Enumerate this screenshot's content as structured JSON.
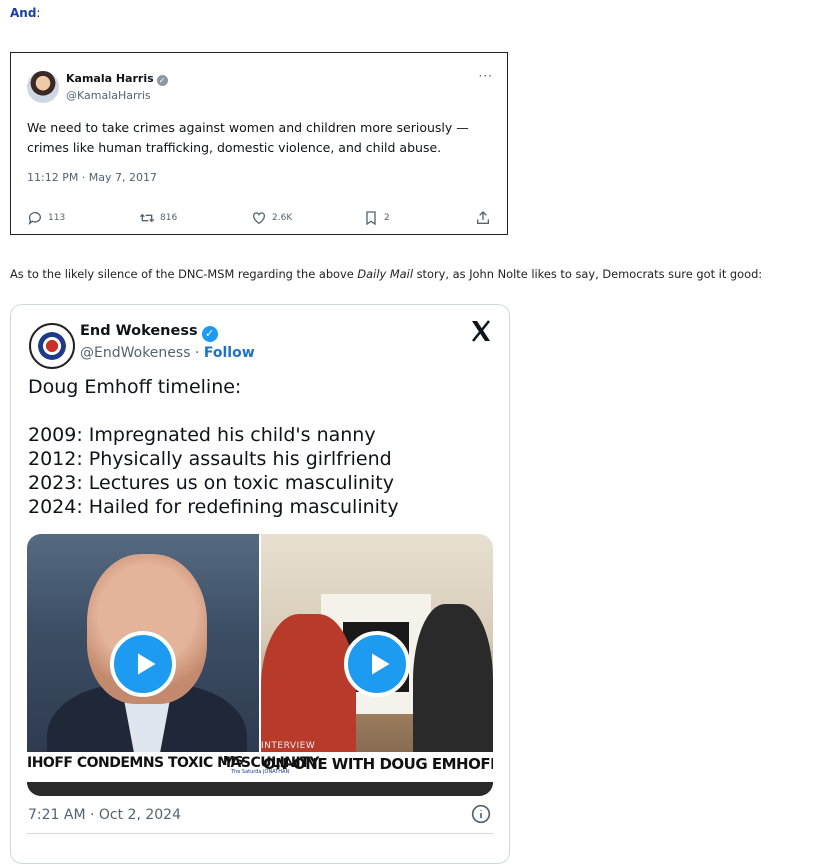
{
  "intro": {
    "bold": "And",
    "colon": ":"
  },
  "tweet1": {
    "name": "Kamala Harris",
    "verified_mark": "✓",
    "handle": "@KamalaHarris",
    "more": "···",
    "text": "We need to take crimes against women and children more seriously — crimes like human trafficking, domestic violence, and child abuse.",
    "timestamp": "11:12 PM · May 7, 2017",
    "replies": "113",
    "retweets": "816",
    "likes": "2.6K",
    "bookmarks": "2",
    "icons": [
      "reply-icon",
      "retweet-icon",
      "like-icon",
      "bookmark-icon",
      "share-icon"
    ]
  },
  "paragraph": {
    "before": "As to the likely silence of the DNC-MSM regarding the above ",
    "italic": "Daily Mail",
    "after": " story, as John Nolte likes to say, Democrats sure got it good:"
  },
  "tweet2": {
    "name": "End Wokeness",
    "verified_mark": "✓",
    "handle": "@EndWokeness",
    "dot": " · ",
    "follow": "Follow",
    "lines": [
      "Doug Emhoff timeline:",
      "",
      "2009: Impregnated his child's nanny",
      "2012: Physically assaults his girlfriend",
      "2023: Lectures us on toxic masculinity",
      "2024: Hailed for redefining masculinity"
    ],
    "video_left_caption": "IHOFF CONDEMNS TOXIC MASCULINITY",
    "video_left_logo": "MS",
    "video_left_tiny": "The Saturda JONATHAN",
    "video_right_tag": "INTERVIEW",
    "video_right_caption": "ON-ONE WITH DOUG EMHOFF",
    "timestamp": "7:21 AM · Oct 2, 2024"
  },
  "colors": {
    "link_blue": "#1d9bf0",
    "follow_blue": "#1d73c0",
    "intro_blue": "#1a3ea8",
    "muted": "#536471"
  }
}
